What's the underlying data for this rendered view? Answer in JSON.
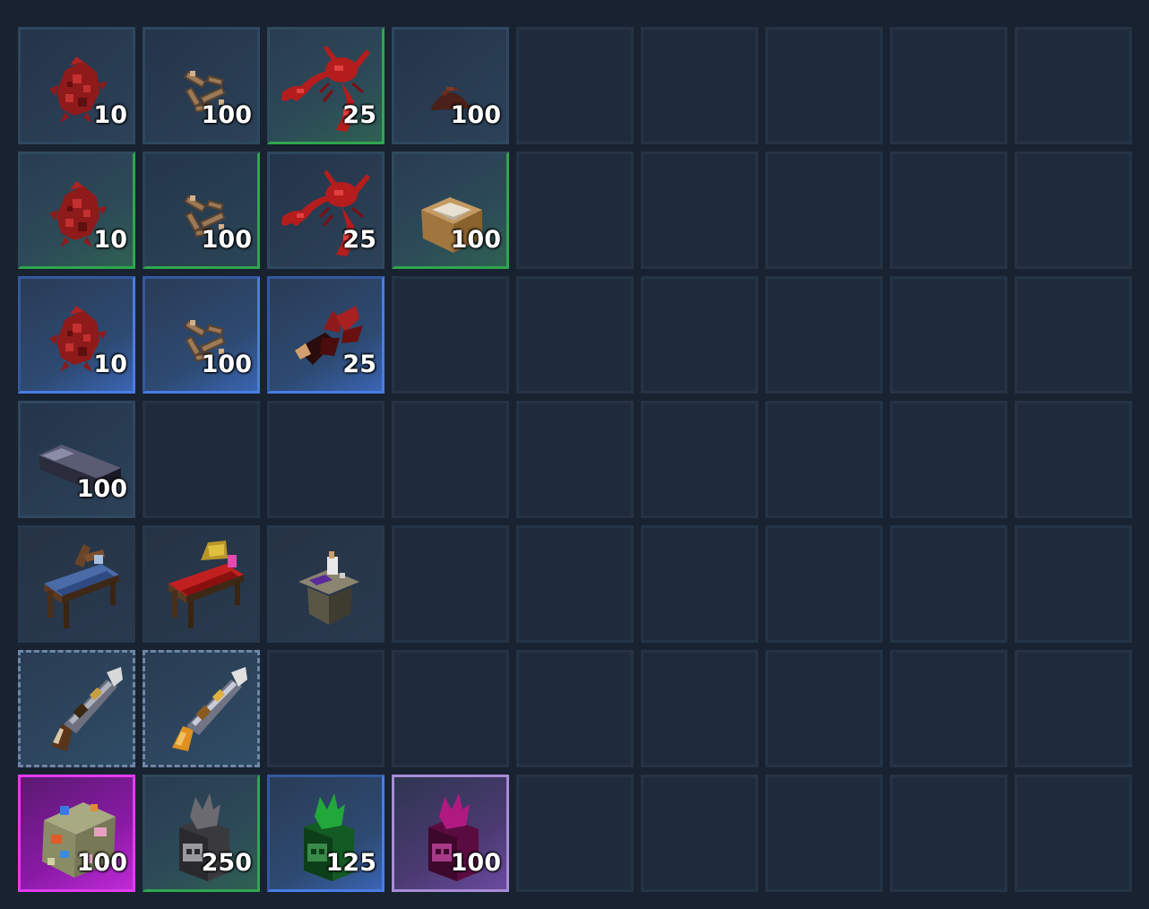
{
  "inventory": {
    "columns": 9,
    "rows": 7,
    "slots": [
      {
        "item": "red-ore-cluster-icon",
        "count": "10",
        "tier": "common"
      },
      {
        "item": "bone-pile-icon",
        "count": "100",
        "tier": "common"
      },
      {
        "item": "red-lobster-icon",
        "count": "25",
        "tier": "green"
      },
      {
        "item": "dirt-clump-icon",
        "count": "100",
        "tier": "common"
      },
      null,
      null,
      null,
      null,
      null,
      {
        "item": "red-ore-cluster-icon",
        "count": "10",
        "tier": "green"
      },
      {
        "item": "bone-pile-icon",
        "count": "100",
        "tier": "greenfade"
      },
      {
        "item": "red-lobster-icon",
        "count": "25",
        "tier": "common"
      },
      {
        "item": "wooden-box-icon",
        "count": "100",
        "tier": "green"
      },
      null,
      null,
      null,
      null,
      null,
      {
        "item": "red-ore-cluster-icon",
        "count": "10",
        "tier": "blue"
      },
      {
        "item": "bone-pile-icon",
        "count": "100",
        "tier": "blue"
      },
      {
        "item": "red-claw-icon",
        "count": "25",
        "tier": "blue"
      },
      null,
      null,
      null,
      null,
      null,
      null,
      {
        "item": "metal-ingot-icon",
        "count": "100",
        "tier": "common"
      },
      null,
      null,
      null,
      null,
      null,
      null,
      null,
      null,
      {
        "item": "blue-crafting-bench-icon",
        "count": "",
        "tier": "dark"
      },
      {
        "item": "red-crafting-bench-icon",
        "count": "",
        "tier": "dark"
      },
      {
        "item": "alchemy-table-icon",
        "count": "",
        "tier": "dark"
      },
      null,
      null,
      null,
      null,
      null,
      null,
      {
        "item": "blunderbuss-icon",
        "count": "",
        "tier": "dashed"
      },
      {
        "item": "golden-blunderbuss-icon",
        "count": "",
        "tier": "dashed"
      },
      null,
      null,
      null,
      null,
      null,
      null,
      null,
      {
        "item": "coral-block-icon",
        "count": "100",
        "tier": "epic"
      },
      {
        "item": "grey-skull-urn-icon",
        "count": "250",
        "tier": "green"
      },
      {
        "item": "green-skull-urn-icon",
        "count": "125",
        "tier": "blue"
      },
      {
        "item": "magenta-skull-urn-icon",
        "count": "100",
        "tier": "purple"
      },
      null,
      null,
      null,
      null,
      null
    ]
  },
  "colors": {
    "background": "#182230",
    "slot_empty": "#1f2b3a",
    "rarity_green": "#2fa64f",
    "rarity_blue": "#4a7ce6",
    "rarity_epic": "#e13cf0",
    "rarity_purple": "#a78cd6"
  }
}
